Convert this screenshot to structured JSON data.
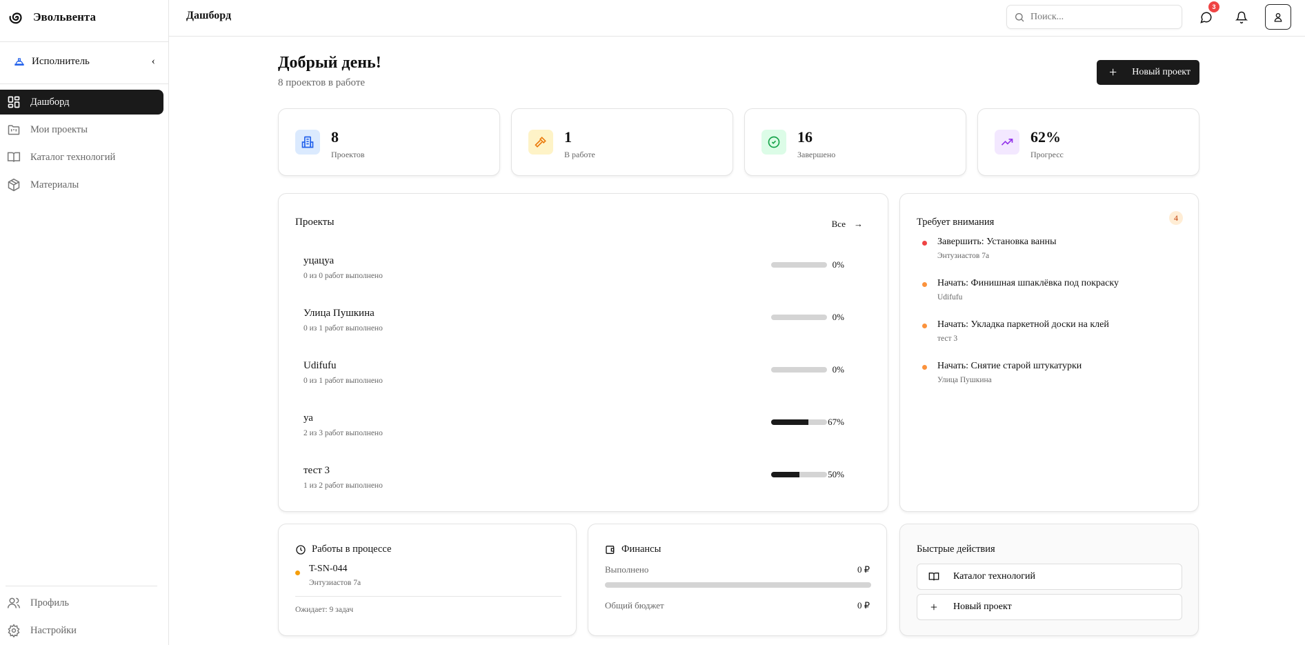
{
  "sidebar": {
    "brand": "Эвольвента",
    "role": "Исполнитель",
    "nav": [
      {
        "label": "Дашборд",
        "icon": "dashboard-icon",
        "active": true
      },
      {
        "label": "Мои проекты",
        "icon": "folder-icon"
      },
      {
        "label": "Каталог технологий",
        "icon": "book-icon"
      },
      {
        "label": "Материалы",
        "icon": "package-icon"
      }
    ],
    "bottom": [
      {
        "label": "Профиль",
        "icon": "users-icon"
      },
      {
        "label": "Настройки",
        "icon": "gear-icon"
      }
    ]
  },
  "header": {
    "title": "Дашборд",
    "search_placeholder": "Поиск...",
    "messages_badge": "3"
  },
  "main": {
    "greeting": "Добрый день!",
    "subtitle": "8 проектов в работе",
    "new_project": "Новый проект",
    "stats": [
      {
        "value": "8",
        "label": "Проектов",
        "color": "#2563eb",
        "bg": "#dbeafe"
      },
      {
        "value": "1",
        "label": "В работе",
        "color": "#ea7a0c",
        "bg": "#fef3c7"
      },
      {
        "value": "16",
        "label": "Завершено",
        "color": "#16a34a",
        "bg": "#dcfce7"
      },
      {
        "value": "62%",
        "label": "Прогресс",
        "color": "#9333ea",
        "bg": "#f3e8ff"
      }
    ],
    "projects": {
      "title": "Проекты",
      "all_link": "Все",
      "items": [
        {
          "name": "уцацуа",
          "desc": "0 из 0 работ выполнено",
          "percent": "0%",
          "progress": 0
        },
        {
          "name": "Улица Пушкина",
          "desc": "0 из 1 работ выполнено",
          "percent": "0%",
          "progress": 0
        },
        {
          "name": "Udifufu",
          "desc": "0 из 1 работ выполнено",
          "percent": "0%",
          "progress": 0
        },
        {
          "name": "уа",
          "desc": "2 из 3 работ выполнено",
          "percent": "67%",
          "progress": 67
        },
        {
          "name": "тест 3",
          "desc": "1 из 2 работ выполнено",
          "percent": "50%",
          "progress": 50
        }
      ]
    },
    "attention": {
      "title": "Требует внимания",
      "count": "4",
      "items": [
        {
          "title": "Завершить: Установка ванны",
          "sub": "Энтузиастов 7а",
          "color": "#ef4444"
        },
        {
          "title": "Начать: Финишная шпаклёвка под покраску",
          "sub": "Udifufu",
          "color": "#fb923c"
        },
        {
          "title": "Начать: Укладка паркетной доски на клей",
          "sub": "тест 3",
          "color": "#fb923c"
        },
        {
          "title": "Начать: Снятие старой штукатурки",
          "sub": "Улица Пушкина",
          "color": "#fb923c"
        }
      ]
    },
    "in_progress": {
      "title": "Работы в процессе",
      "item_code": "T-SN-044",
      "item_address": "Энтузиастов 7а",
      "waiting": "Ожидает: 9 задач"
    },
    "finance": {
      "title": "Финансы",
      "done_label": "Выполнено",
      "done_value": "0 ₽",
      "progress": 0,
      "budget_label": "Общий бюджет",
      "budget_value": "0 ₽"
    },
    "quick": {
      "title": "Быстрые действия",
      "catalog": "Каталог технологий",
      "new_project": "Новый проект"
    }
  }
}
